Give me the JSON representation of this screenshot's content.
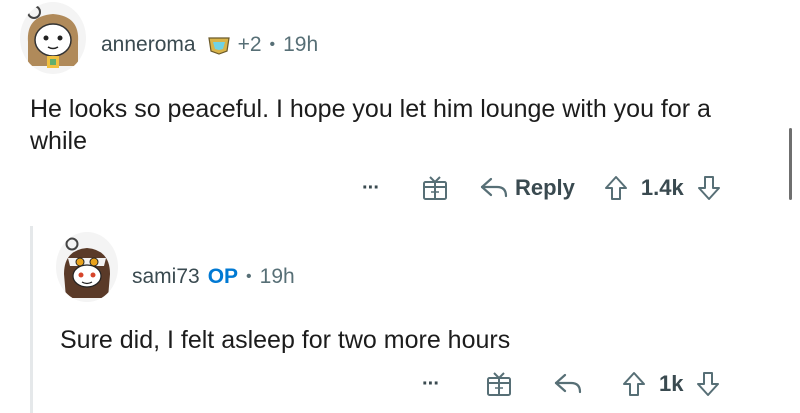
{
  "comment1": {
    "username": "anneroma",
    "award_count": "+2",
    "separator": "•",
    "time": "19h",
    "body": "He looks so peaceful. I hope you let him lounge with you for a while",
    "actions": {
      "more": "···",
      "reply": "Reply",
      "score": "1.4k"
    }
  },
  "comment2": {
    "username": "sami73",
    "op_badge": "OP",
    "separator": "•",
    "time": "19h",
    "body": "Sure did, I felt asleep for two more hours",
    "actions": {
      "more": "···",
      "score": "1k"
    }
  },
  "colors": {
    "op": "#0079d3",
    "meta": "#576f76",
    "text": "#1c1c1c"
  }
}
